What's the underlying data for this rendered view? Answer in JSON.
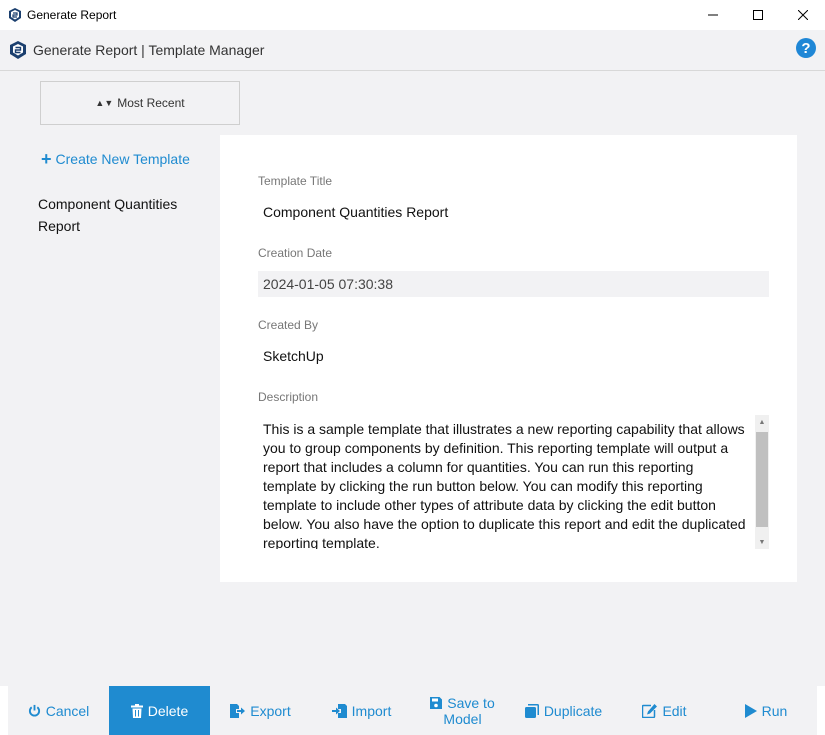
{
  "window": {
    "title": "Generate Report"
  },
  "header": {
    "title": "Generate Report | Template Manager"
  },
  "sidebar": {
    "sort_label": "Most Recent",
    "create_label": "Create New Template",
    "templates": [
      {
        "name": "Component Quantities Report"
      }
    ]
  },
  "form": {
    "title_label": "Template Title",
    "title_value": "Component Quantities Report",
    "date_label": "Creation Date",
    "date_value": "2024-01-05 07:30:38",
    "created_by_label": "Created By",
    "created_by_value": "SketchUp",
    "description_label": "Description",
    "description_value": "This is a sample template that illustrates a new reporting capability that allows you to group components by definition. This reporting template will output a report that includes a column for quantities. You can run this reporting template by clicking the run button below. You can modify this reporting template to include other types of attribute data by clicking the edit button below. You also have the option to duplicate this report and edit the duplicated reporting template."
  },
  "toolbar": {
    "cancel": "Cancel",
    "delete": "Delete",
    "export": "Export",
    "import": "Import",
    "save_line1": "Save to",
    "save_line2": "Model",
    "duplicate": "Duplicate",
    "edit": "Edit",
    "run": "Run"
  },
  "colors": {
    "accent": "#1f8bd0",
    "help": "#1f87d6",
    "background": "#f2f2f4"
  },
  "icons": {
    "app": "sketchup-logo-icon",
    "help": "question-circle-icon",
    "sort": "sort-icon",
    "create": "plus-icon",
    "cancel": "power-icon",
    "delete": "trash-icon",
    "export": "export-icon",
    "import": "import-icon",
    "save": "floppy-disk-icon",
    "duplicate": "copy-icon",
    "edit": "edit-icon",
    "run": "play-icon"
  }
}
